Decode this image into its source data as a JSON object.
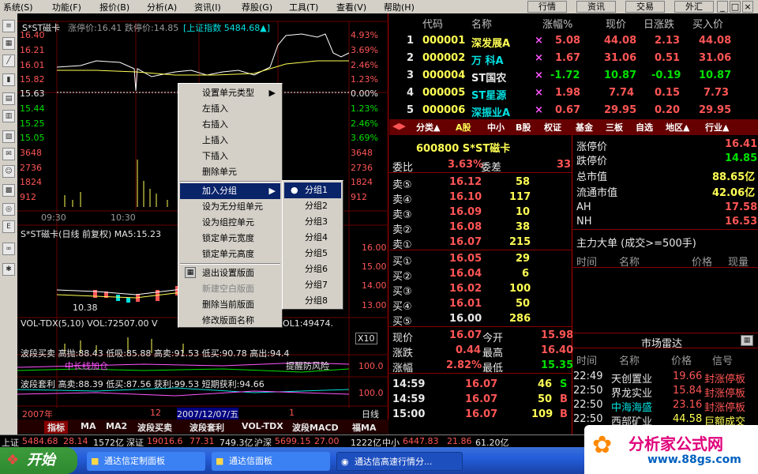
{
  "menu": [
    "系统(S)",
    "功能(F)",
    "报价(B)",
    "分析(A)",
    "资讯(I)",
    "荐股(G)",
    "工具(T)",
    "查看(V)",
    "帮助(H)"
  ],
  "top_buttons": [
    "行情",
    "资讯",
    "交易",
    "外汇"
  ],
  "chart": {
    "title": "S*ST磁卡",
    "limit_up": "涨停价:16.41",
    "limit_down": "跌停价:14.85",
    "index_label": "[上证指数 5484.68▲]",
    "left_prices": [
      "16.40",
      "16.21",
      "16.01",
      "15.82",
      "15.63",
      "15.44",
      "15.25",
      "15.05",
      "3648",
      "2736",
      "1824",
      "912"
    ],
    "right_pcts": [
      "4.93%",
      "3.69%",
      "2.46%",
      "1.23%",
      "0.00%",
      "1.23%",
      "2.46%",
      "3.69%",
      "3648",
      "2736",
      "1824",
      "912"
    ],
    "times": [
      "09:30",
      "10:30"
    ],
    "kline_title": "S*ST磁卡(日线 前复权) MA5:15.23",
    "kline_right": [
      "16.00",
      "15.00",
      "14.00",
      "13.00"
    ],
    "kline_low": "10.38",
    "vol_label": "VOL-TDX(5,10) VOL:72507.00 V",
    "vol_label2": "OL1:49474.",
    "vol_x10": "X10",
    "wave_label": "波段买卖 高抛:88.43 低吸:85.88 高卖:91.53 低买:90.78 高出:94.4",
    "wave_note_left": "中长线加仓",
    "wave_note_right": "提醒防风险",
    "arb_label": "波段套利 高卖:88.39 低买:87.56 获利:99.53 短期获利:94.66",
    "wave_right": [
      "100.0",
      "100.0"
    ],
    "dates": [
      "2007年",
      "12",
      "2007/12/07/五",
      "1",
      "日线"
    ],
    "bottom_tabs": [
      "指标",
      "MA",
      "MA2",
      "波段买卖",
      "波段套利",
      "VOL-TDX",
      "波段MACD",
      "福MA"
    ]
  },
  "context_menu": [
    "设置单元类型",
    "左插入",
    "右插入",
    "上插入",
    "下插入",
    "删除单元",
    "加入分组",
    "设为无分组单元",
    "设为组控单元",
    "锁定单元宽度",
    "锁定单元高度",
    "退出设置版面",
    "新建空白版面",
    "删除当前版面",
    "修改版面名称"
  ],
  "submenu": [
    "分组1",
    "分组2",
    "分组3",
    "分组4",
    "分组5",
    "分组6",
    "分组7",
    "分组8"
  ],
  "quote_headers": [
    "代码",
    "名称",
    "涨幅%",
    "现价",
    "日涨跌",
    "买入价"
  ],
  "quotes": [
    {
      "n": "1",
      "code": "000001",
      "name": "深发展A",
      "pct": "5.08",
      "price": "44.08",
      "chg": "2.13",
      "bid": "44.08"
    },
    {
      "n": "2",
      "code": "000002",
      "name": "万 科A",
      "pct": "1.67",
      "price": "31.06",
      "chg": "0.51",
      "bid": "31.06"
    },
    {
      "n": "3",
      "code": "000004",
      "name": "ST国农",
      "pct": "-1.72",
      "price": "10.87",
      "chg": "-0.19",
      "bid": "10.87"
    },
    {
      "n": "4",
      "code": "000005",
      "name": "ST星源",
      "pct": "1.98",
      "price": "7.74",
      "chg": "0.15",
      "bid": "7.73"
    },
    {
      "n": "5",
      "code": "000006",
      "name": "深振业A",
      "pct": "0.67",
      "price": "29.95",
      "chg": "0.20",
      "bid": "29.95"
    }
  ],
  "market_tabs": [
    "分类▲",
    "A股",
    "中小",
    "B股",
    "权证",
    "基金",
    "三板",
    "自选",
    "地区▲",
    "行业▲"
  ],
  "stock": {
    "code_name": "600800 S*ST磁卡",
    "wb": "委比",
    "wb_val": "3.63%",
    "wc": "委差",
    "wc_val": "33",
    "asks": [
      [
        "卖⑤",
        "16.12",
        "58"
      ],
      [
        "卖④",
        "16.10",
        "117"
      ],
      [
        "卖③",
        "16.09",
        "10"
      ],
      [
        "卖②",
        "16.08",
        "38"
      ],
      [
        "卖①",
        "16.07",
        "215"
      ]
    ],
    "bids": [
      [
        "买①",
        "16.05",
        "29"
      ],
      [
        "买②",
        "16.04",
        "6"
      ],
      [
        "买③",
        "16.02",
        "100"
      ],
      [
        "买④",
        "16.01",
        "50"
      ],
      [
        "买⑤",
        "16.00",
        "286"
      ]
    ],
    "now": "现价",
    "now_v": "16.07",
    "open": "今开",
    "open_v": "15.98",
    "chg": "涨跌",
    "chg_v": "0.44",
    "high": "最高",
    "high_v": "16.40",
    "pct": "涨幅",
    "pct_v": "2.82%",
    "low": "最低",
    "low_v": "15.35",
    "ticks": [
      [
        "14:59",
        "16.07",
        "46",
        "S"
      ],
      [
        "14:59",
        "16.07",
        "50",
        "B"
      ],
      [
        "15:00",
        "16.07",
        "109",
        "B"
      ]
    ]
  },
  "info": {
    "limit_up": "涨停价",
    "limit_up_v": "16.41",
    "limit_down": "跌停价",
    "limit_down_v": "14.85",
    "cap": "总市值",
    "cap_v": "88.65亿",
    "float": "流通市值",
    "float_v": "42.06亿",
    "ah": "AH",
    "ah_v": "17.58",
    "nh": "NH",
    "nh_v": "16.53",
    "big_order": "主力大单 (成交>=500手)",
    "cols": [
      "时间",
      "名称",
      "价格",
      "现量"
    ],
    "radar": "市场雷达",
    "radar_cols": [
      "时间",
      "名称",
      "价格",
      "信号"
    ],
    "radar_rows": [
      [
        "22:49",
        "天创置业",
        "19.66",
        "封涨停板"
      ],
      [
        "22:50",
        "界龙实业",
        "15.84",
        "封涨停板"
      ],
      [
        "22:50",
        "中海海盛",
        "23.16",
        "封涨停板"
      ],
      [
        "22:50",
        "西部矿业",
        "44.58",
        "巨额成交"
      ]
    ]
  },
  "status": [
    "上证",
    "5484.68",
    "28.14",
    "1572亿",
    "深证",
    "19016.6",
    "77.31",
    "749.3亿",
    "沪深",
    "5699.15",
    "27.00",
    "1222亿",
    "中小",
    "6447.83",
    "21.86",
    "61.20亿"
  ],
  "start": "开始",
  "tasks": [
    "通达信定制面板",
    "通达信面板",
    "通达信高速行情分..."
  ],
  "logo_text": "分析家公式网",
  "logo_url": "www.88gs.com",
  "colors": {
    "up": "#ff5555",
    "down": "#00e000",
    "menu_bg": "#d4d0c8",
    "highlight": "#0a246a"
  }
}
